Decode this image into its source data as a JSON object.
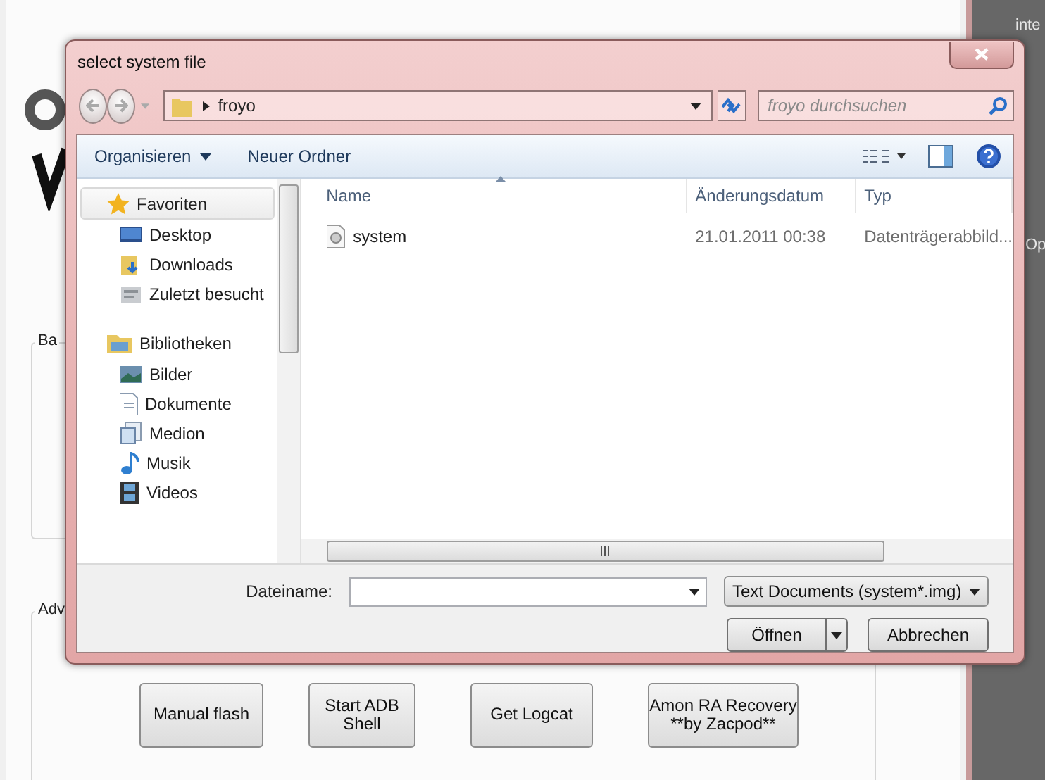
{
  "background_window": {
    "side_texts": [
      "inte",
      "Op"
    ],
    "group_labels": [
      "Ba",
      "Adv"
    ],
    "buttons": [
      "Manual flash",
      "Start ADB Shell",
      "Get Logcat",
      "Amon RA Recovery\n**by Zacpod**"
    ]
  },
  "dialog": {
    "title": "select system file",
    "address": {
      "path": [
        "froyo"
      ]
    },
    "search": {
      "placeholder": "froyo durchsuchen"
    },
    "toolbar": [
      {
        "label": "Organisieren",
        "menu": true
      },
      {
        "label": "Neuer Ordner",
        "menu": false
      }
    ],
    "nav_pane": [
      {
        "label": "Favoriten",
        "selected": true,
        "children": [
          {
            "label": "Desktop"
          },
          {
            "label": "Downloads"
          },
          {
            "label": "Zuletzt besucht"
          }
        ]
      },
      {
        "label": "Bibliotheken",
        "selected": false,
        "children": [
          {
            "label": "Bilder"
          },
          {
            "label": "Dokumente"
          },
          {
            "label": "Medion"
          },
          {
            "label": "Musik"
          },
          {
            "label": "Videos"
          }
        ]
      }
    ],
    "columns": [
      "Name",
      "Änderungsdatum",
      "Typ"
    ],
    "rows": [
      {
        "name": "system",
        "date": "21.01.2011 00:38",
        "type": "Datenträgerabbild...",
        "selected": false
      }
    ],
    "filename_label": "Dateiname:",
    "filter": "Text Documents (system*.img)",
    "buttons": [
      {
        "label": "Öffnen",
        "split": true
      },
      {
        "label": "Abbrechen",
        "split": false
      }
    ]
  }
}
